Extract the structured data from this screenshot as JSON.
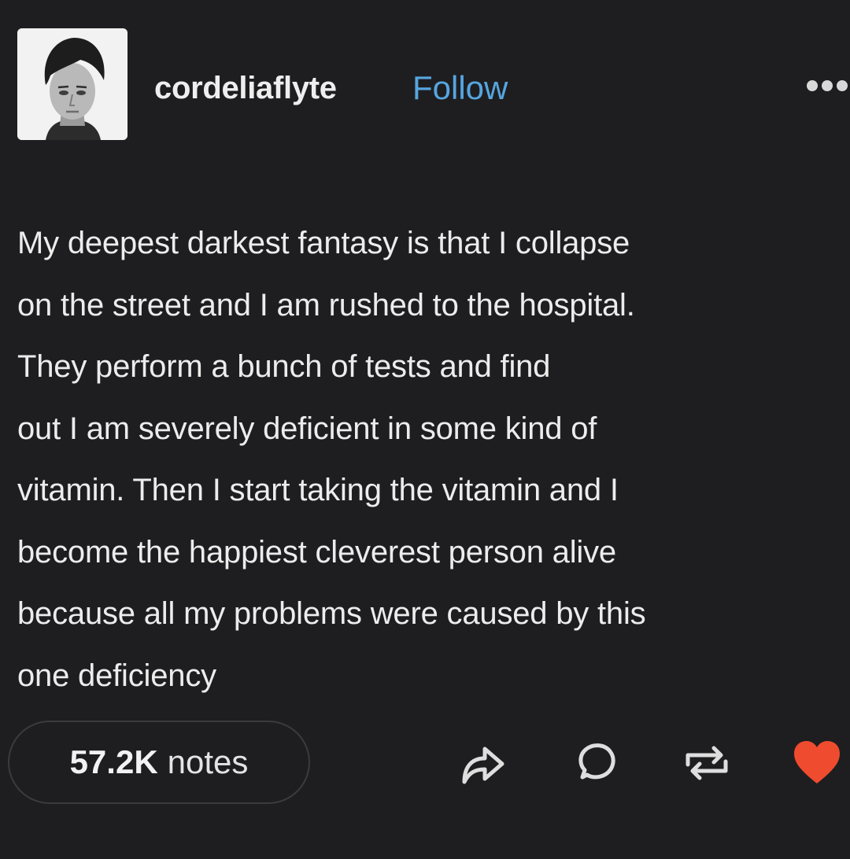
{
  "post": {
    "username": "cordeliaflyte",
    "follow_label": "Follow",
    "more_icon": "more-horizontal-icon",
    "avatar": "avatar-photo",
    "body_lines": [
      "My deepest darkest fantasy is that I collapse",
      "on the street and I am rushed to the hospital.",
      "They perform a bunch of tests and find",
      "out I am severely deficient in some kind of",
      "vitamin. Then I start taking the vitamin and I",
      "become the happiest cleverest person alive",
      "because all my problems were caused by this",
      "one deficiency"
    ]
  },
  "footer": {
    "notes_count": "57.2K",
    "notes_label": "notes",
    "actions": [
      {
        "name": "share",
        "icon": "share-icon"
      },
      {
        "name": "reply",
        "icon": "reply-icon"
      },
      {
        "name": "reblog",
        "icon": "reblog-icon"
      },
      {
        "name": "like",
        "icon": "heart-icon",
        "liked": true
      }
    ]
  },
  "colors": {
    "background": "#1e1e20",
    "text": "#ececec",
    "follow": "#56a6e0",
    "heart": "#ef4b2e",
    "icon": "#dedede"
  }
}
